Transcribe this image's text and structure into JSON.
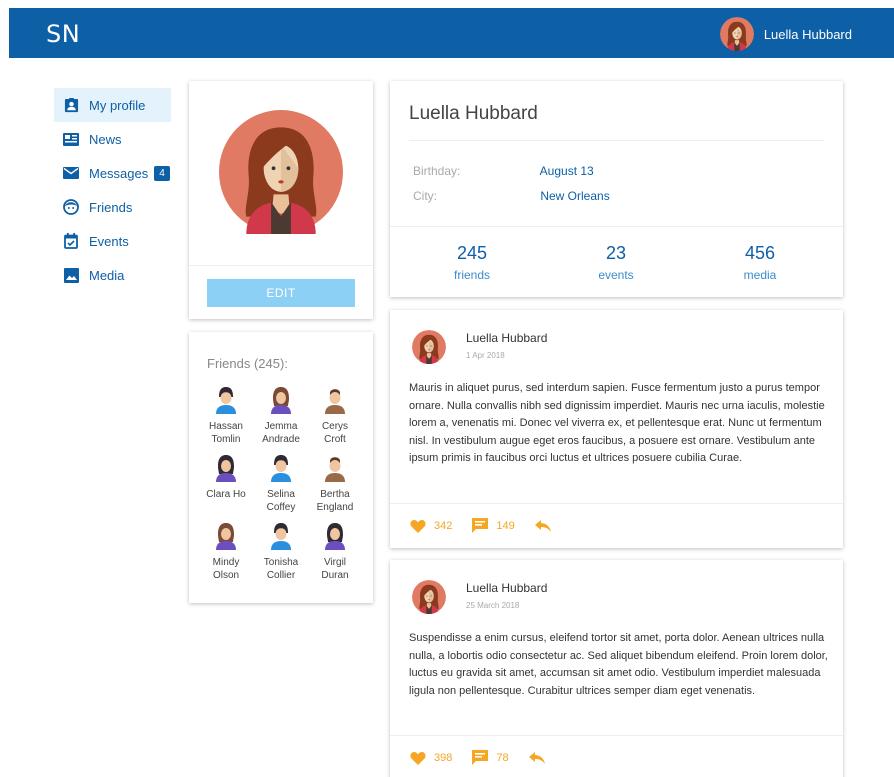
{
  "header": {
    "logo": "SN",
    "user_name": "Luella Hubbard"
  },
  "sidebar": {
    "items": [
      {
        "label": "My profile",
        "icon": "profile-icon",
        "active": true
      },
      {
        "label": "News",
        "icon": "news-icon"
      },
      {
        "label": "Messages",
        "icon": "mail-icon",
        "badge": "4"
      },
      {
        "label": "Friends",
        "icon": "friends-icon"
      },
      {
        "label": "Events",
        "icon": "calendar-icon"
      },
      {
        "label": "Media",
        "icon": "image-icon"
      }
    ]
  },
  "profile": {
    "edit_label": "EDIT"
  },
  "friends": {
    "title": "Friends (245):",
    "list": [
      {
        "first": "Hassan",
        "last": "Tomlin"
      },
      {
        "first": "Jemma",
        "last": "Andrade"
      },
      {
        "first": "Cerys",
        "last": "Croft"
      },
      {
        "first": "Clara Ho",
        "last": ""
      },
      {
        "first": "Selina",
        "last": "Coffey"
      },
      {
        "first": "Bertha",
        "last": "England"
      },
      {
        "first": "Mindy",
        "last": "Olson"
      },
      {
        "first": "Tonisha",
        "last": "Collier"
      },
      {
        "first": "Virgil",
        "last": "Duran"
      }
    ]
  },
  "info": {
    "name": "Luella Hubbard",
    "birthday_label": "Birthday:",
    "birthday": "August 13",
    "city_label": "City:",
    "city": "New Orleans",
    "stats": [
      {
        "value": "245",
        "label": "friends"
      },
      {
        "value": "23",
        "label": "events"
      },
      {
        "value": "456",
        "label": "media"
      }
    ]
  },
  "posts": [
    {
      "author": "Luella Hubbard",
      "date": "1 Apr 2018",
      "text": "Mauris in aliquet purus, sed interdum sapien. Fusce fermentum justo a purus tempor ornare. Nulla convallis nibh sed dignissim imperdiet. Mauris nec urna iaculis, molestie lorem a, venenatis mi. Donec vel viverra ex, et pellentesque erat. Nunc ut fermentum nisl. In vestibulum augue eget eros faucibus, a posuere est ornare. Vestibulum ante ipsum primis in faucibus orci luctus et ultrices posuere cubilia Curae.",
      "likes": "342",
      "comments": "149"
    },
    {
      "author": "Luella Hubbard",
      "date": "25 March 2018",
      "text": "Suspendisse a enim cursus, eleifend tortor sit amet, porta dolor. Aenean ultrices nulla nulla, a lobortis odio consectetur ac. Sed aliquet bibendum eleifend. Proin lorem dolor, luctus eu gravida sit amet, accumsan sit amet odio. Vestibulum imperdiet malesuada ligula non pellentesque. Curabitur ultrices semper diam eget venenatis.",
      "likes": "398",
      "comments": "78"
    }
  ],
  "colors": {
    "primary": "#0d5fa6",
    "accent": "#f5a623",
    "edit_button": "#8dd0f5"
  }
}
